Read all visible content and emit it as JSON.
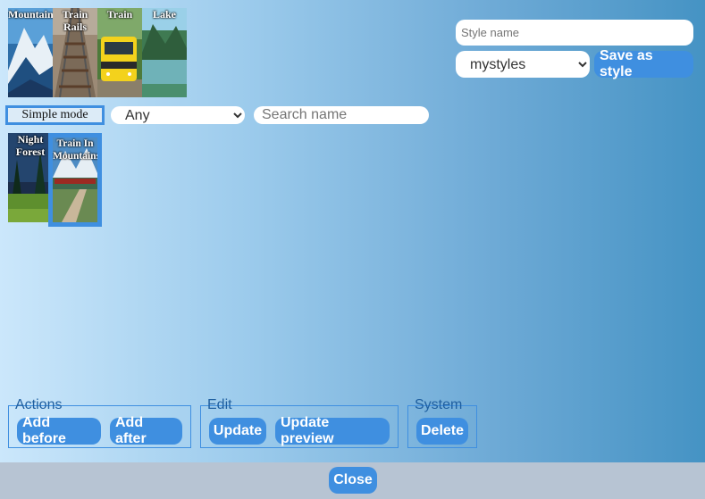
{
  "top_gallery": [
    {
      "label": "Mountains",
      "art": "mountains"
    },
    {
      "label": "Train\nRails",
      "art": "rails"
    },
    {
      "label": "Train",
      "art": "train"
    },
    {
      "label": "Lake",
      "art": "lake"
    }
  ],
  "style_name": {
    "placeholder": "Style name",
    "value": ""
  },
  "style_select": {
    "selected": "mystyles"
  },
  "save_style_label": "Save as style",
  "simple_mode_label": "Simple mode",
  "filter_select": {
    "selected": "Any"
  },
  "search": {
    "placeholder": "Search name"
  },
  "results": [
    {
      "label": "Night\nForest",
      "art": "forest"
    },
    {
      "label": "Train In\nMountains",
      "art": "trainmtn",
      "selected": true
    }
  ],
  "groups": {
    "actions": {
      "legend": "Actions",
      "add_before": "Add before",
      "add_after": "Add after"
    },
    "edit": {
      "legend": "Edit",
      "update": "Update",
      "update_preview": "Update preview"
    },
    "system": {
      "legend": "System",
      "delete": "Delete"
    }
  },
  "close_label": "Close",
  "colors": {
    "accent": "#3f8fe0",
    "selected_border": "#3f8fe0",
    "footer": "#b7c4d3"
  }
}
